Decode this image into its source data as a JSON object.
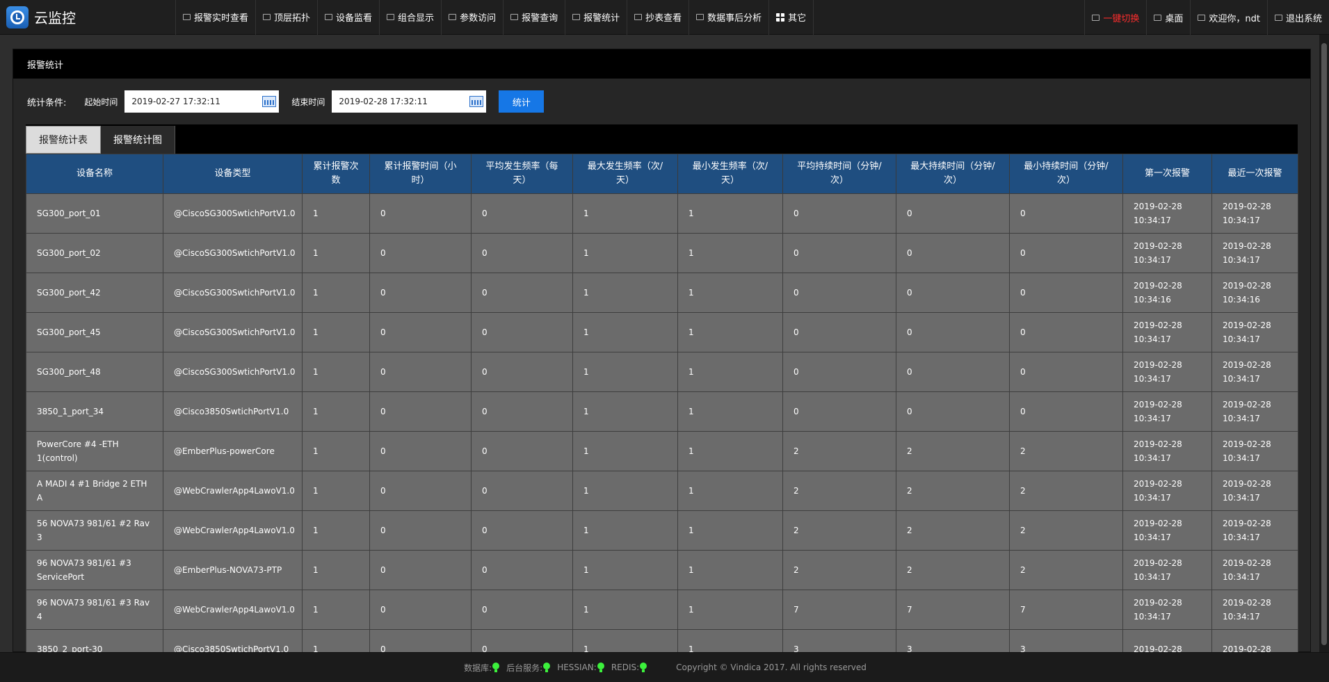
{
  "app": {
    "title": "云监控"
  },
  "nav": {
    "items": [
      {
        "label": "报警实时查看",
        "icon": "monitor-icon"
      },
      {
        "label": "顶层拓扑",
        "icon": "topology-icon"
      },
      {
        "label": "设备监看",
        "icon": "device-icon"
      },
      {
        "label": "组合显示",
        "icon": "combine-icon"
      },
      {
        "label": "参数访问",
        "icon": "params-icon"
      },
      {
        "label": "报警查询",
        "icon": "speaker-icon"
      },
      {
        "label": "报警统计",
        "icon": "chart-icon"
      },
      {
        "label": "抄表查看",
        "icon": "meter-icon"
      },
      {
        "label": "数据事后分析",
        "icon": "analysis-icon"
      },
      {
        "label": "其它",
        "icon": "grid-icon"
      }
    ],
    "right": {
      "switch": "一键切换",
      "desktop": "桌面",
      "welcome": "欢迎你，ndt",
      "logout": "退出系统"
    }
  },
  "panel": {
    "title": "报警统计"
  },
  "filters": {
    "label": "统计条件:",
    "start_label": "起始时间",
    "start_value": "2019-02-27 17:32:11",
    "end_label": "结束时间",
    "end_value": "2019-02-28 17:32:11",
    "submit": "统计"
  },
  "tabs": [
    "报警统计表",
    "报警统计图"
  ],
  "table": {
    "headers": [
      "设备名称",
      "设备类型",
      "累计报警次数",
      "累计报警时间（小时）",
      "平均发生频率（每天）",
      "最大发生频率（次/天）",
      "最小发生频率（次/天）",
      "平均持续时间（分钟/次）",
      "最大持续时间（分钟/次）",
      "最小持续时间（分钟/次）",
      "第一次报警",
      "最近一次报警"
    ],
    "rows": [
      [
        "SG300_port_01",
        "@CiscoSG300SwtichPortV1.0",
        "1",
        "0",
        "0",
        "1",
        "1",
        "0",
        "0",
        "0",
        "2019-02-28 10:34:17",
        "2019-02-28 10:34:17"
      ],
      [
        "SG300_port_02",
        "@CiscoSG300SwtichPortV1.0",
        "1",
        "0",
        "0",
        "1",
        "1",
        "0",
        "0",
        "0",
        "2019-02-28 10:34:17",
        "2019-02-28 10:34:17"
      ],
      [
        "SG300_port_42",
        "@CiscoSG300SwtichPortV1.0",
        "1",
        "0",
        "0",
        "1",
        "1",
        "0",
        "0",
        "0",
        "2019-02-28 10:34:16",
        "2019-02-28 10:34:16"
      ],
      [
        "SG300_port_45",
        "@CiscoSG300SwtichPortV1.0",
        "1",
        "0",
        "0",
        "1",
        "1",
        "0",
        "0",
        "0",
        "2019-02-28 10:34:17",
        "2019-02-28 10:34:17"
      ],
      [
        "SG300_port_48",
        "@CiscoSG300SwtichPortV1.0",
        "1",
        "0",
        "0",
        "1",
        "1",
        "0",
        "0",
        "0",
        "2019-02-28 10:34:17",
        "2019-02-28 10:34:17"
      ],
      [
        "3850_1_port_34",
        "@Cisco3850SwtichPortV1.0",
        "1",
        "0",
        "0",
        "1",
        "1",
        "0",
        "0",
        "0",
        "2019-02-28 10:34:17",
        "2019-02-28 10:34:17"
      ],
      [
        "PowerCore #4 -ETH 1(control)",
        "@EmberPlus-powerCore",
        "1",
        "0",
        "0",
        "1",
        "1",
        "2",
        "2",
        "2",
        "2019-02-28 10:34:17",
        "2019-02-28 10:34:17"
      ],
      [
        "A MADI 4 #1 Bridge 2 ETH A",
        "@WebCrawlerApp4LawoV1.0",
        "1",
        "0",
        "0",
        "1",
        "1",
        "2",
        "2",
        "2",
        "2019-02-28 10:34:17",
        "2019-02-28 10:34:17"
      ],
      [
        "56 NOVA73 981/61 #2 Rav 3",
        "@WebCrawlerApp4LawoV1.0",
        "1",
        "0",
        "0",
        "1",
        "1",
        "2",
        "2",
        "2",
        "2019-02-28 10:34:17",
        "2019-02-28 10:34:17"
      ],
      [
        "96 NOVA73 981/61 #3 ServicePort",
        "@EmberPlus-NOVA73-PTP",
        "1",
        "0",
        "0",
        "1",
        "1",
        "2",
        "2",
        "2",
        "2019-02-28 10:34:17",
        "2019-02-28 10:34:17"
      ],
      [
        "96 NOVA73 981/61 #3 Rav 4",
        "@WebCrawlerApp4LawoV1.0",
        "1",
        "0",
        "0",
        "1",
        "1",
        "7",
        "7",
        "7",
        "2019-02-28 10:34:17",
        "2019-02-28 10:34:17"
      ],
      [
        "3850_2_port-30",
        "@Cisco3850SwtichPortV1.0",
        "1",
        "0",
        "0",
        "1",
        "1",
        "3",
        "3",
        "3",
        "2019-02-28",
        "2019-02-28"
      ]
    ]
  },
  "footer": {
    "db": "数据库:",
    "backend": "后台服务:",
    "hessian": "HESSIAN:",
    "redis": "REDIS:",
    "copyright": "Copyright © Vindica 2017. All rights reserved",
    "status_color": "#3cf03c"
  }
}
